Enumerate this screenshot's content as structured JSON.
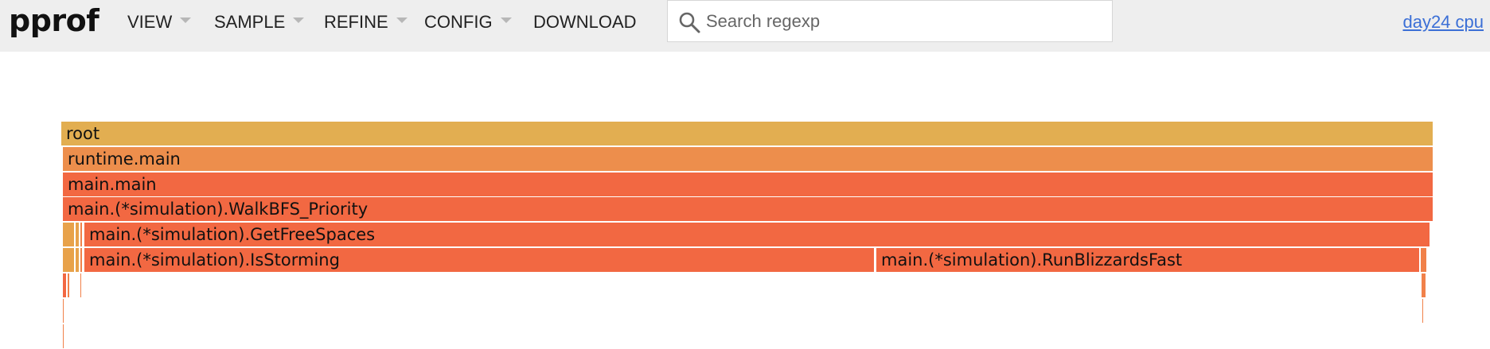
{
  "app": {
    "logo": "pprof",
    "profile_link": "day24 cpu"
  },
  "menu": [
    {
      "label": "VIEW",
      "has_caret": true
    },
    {
      "label": "SAMPLE",
      "has_caret": true
    },
    {
      "label": "REFINE",
      "has_caret": true
    },
    {
      "label": "CONFIG",
      "has_caret": true
    },
    {
      "label": "DOWNLOAD",
      "has_caret": false
    }
  ],
  "search": {
    "placeholder": "Search regexp",
    "value": "",
    "icon": "search-icon"
  },
  "flamegraph": {
    "colors": {
      "root": "#e2ae51",
      "runtime": "#ed8e4c",
      "main": "#f26842",
      "narrow_gold": "#e8a24a",
      "narrow_orange": "#f1814a"
    },
    "frames": [
      {
        "label": "root"
      },
      {
        "label": "runtime.main"
      },
      {
        "label": "main.main"
      },
      {
        "label": "main.(*simulation).WalkBFS_Priority"
      },
      {
        "label": "main.(*simulation).GetFreeSpaces"
      },
      {
        "label": "main.(*simulation).IsStorming"
      },
      {
        "label": "main.(*simulation).RunBlizzardsFast"
      }
    ]
  }
}
